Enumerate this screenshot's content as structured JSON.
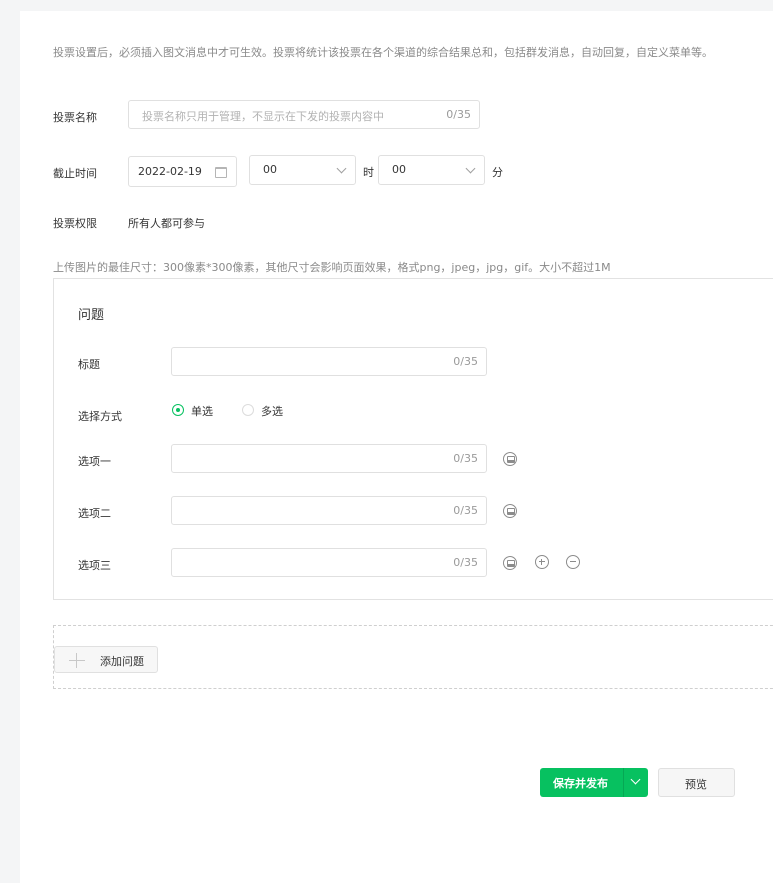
{
  "notice": "投票设置后，必须插入图文消息中才可生效。投票将统计该投票在各个渠道的综合结果总和，包括群发消息，自动回复，自定义菜单等。",
  "vote_name": {
    "label": "投票名称",
    "placeholder": "投票名称只用于管理，不显示在下发的投票内容中",
    "counter": "0/35"
  },
  "deadline": {
    "label": "截止时间",
    "date": "2022-02-19",
    "hour": "00",
    "hour_unit": "时",
    "minute": "00",
    "minute_unit": "分"
  },
  "permission": {
    "label": "投票权限",
    "value": "所有人都可参与"
  },
  "upload_hint": "上传图片的最佳尺寸：300像素*300像素，其他尺寸会影响页面效果，格式png，jpeg，jpg，gif。大小不超过1M",
  "question": {
    "heading": "问题",
    "title_label": "标题",
    "title_counter": "0/35",
    "choice_label": "选择方式",
    "single_label": "单选",
    "multi_label": "多选",
    "options": [
      {
        "label": "选项一",
        "counter": "0/35"
      },
      {
        "label": "选项二",
        "counter": "0/35"
      },
      {
        "label": "选项三",
        "counter": "0/35"
      }
    ]
  },
  "add_question_label": "添加问题",
  "save_publish_label": "保存并发布",
  "preview_label": "预览",
  "colors": {
    "accent": "#07c160",
    "background": "#f4f5f6"
  }
}
